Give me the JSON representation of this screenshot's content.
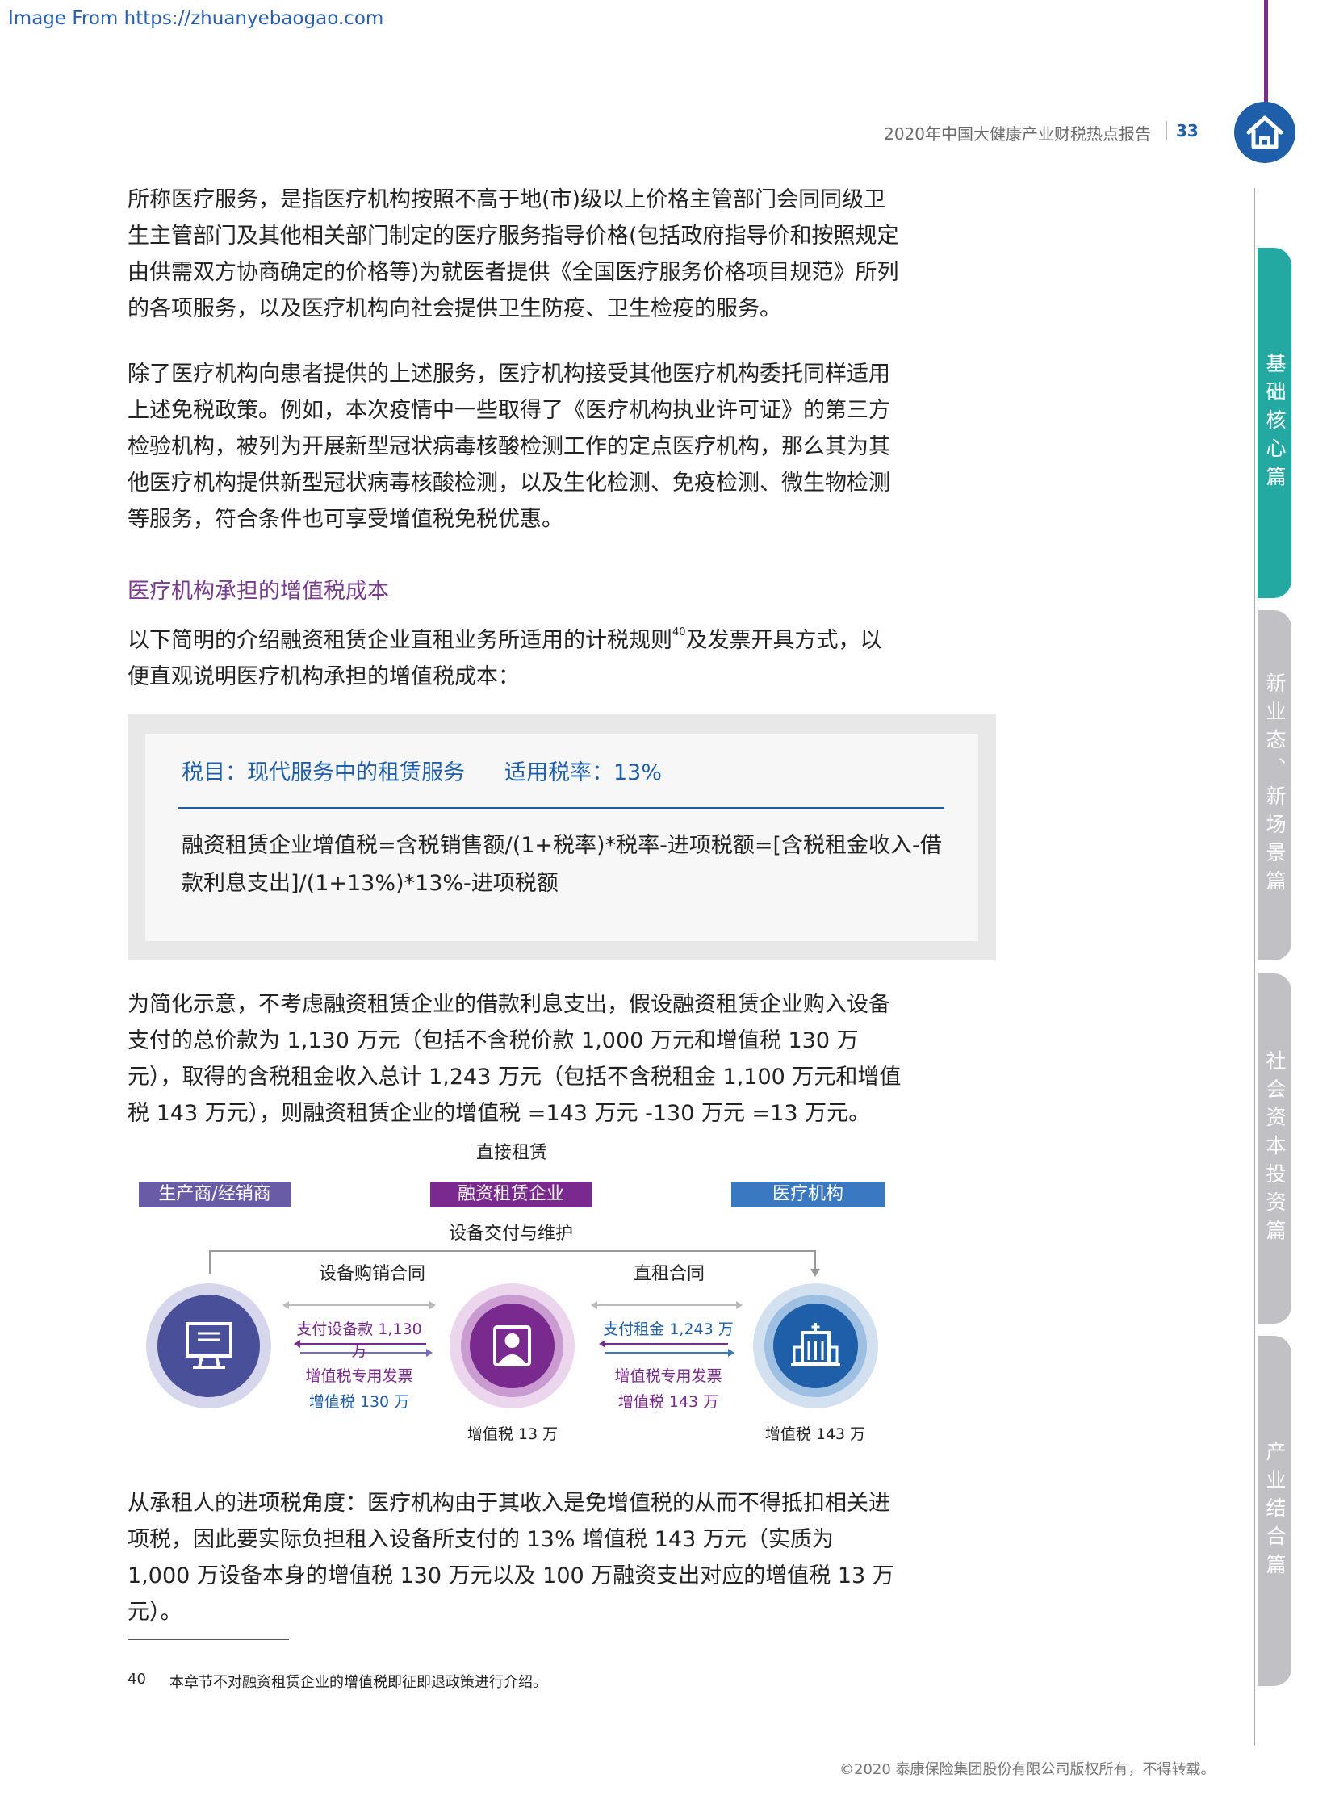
{
  "watermark": "Image From https://zhuanyebaogao.com",
  "header": {
    "title": "2020年中国大健康产业财税热点报告",
    "page_number": "33"
  },
  "side_tabs": [
    {
      "label": "基础核心篇",
      "active": true
    },
    {
      "label": "新业态、新场景篇",
      "active": false
    },
    {
      "label": "社会资本投资篇",
      "active": false
    },
    {
      "label": "产业结合篇",
      "active": false
    }
  ],
  "paragraphs": {
    "p1": "所称医疗服务，是指医疗机构按照不高于地(市)级以上价格主管部门会同同级卫生主管部门及其他相关部门制定的医疗服务指导价格(包括政府指导价和按照规定由供需双方协商确定的价格等)为就医者提供《全国医疗服务价格项目规范》所列的各项服务，以及医疗机构向社会提供卫生防疫、卫生检疫的服务。",
    "p2": "除了医疗机构向患者提供的上述服务，医疗机构接受其他医疗机构委托同样适用上述免税政策。例如，本次疫情中一些取得了《医疗机构执业许可证》的第三方检验机构，被列为开展新型冠状病毒核酸检测工作的定点医疗机构，那么其为其他医疗机构提供新型冠状病毒核酸检测，以及生化检测、免疫检测、微生物检测等服务，符合条件也可享受增值税免税优惠。",
    "section_title": "医疗机构承担的增值税成本",
    "p3_before": "以下简明的介绍融资租赁企业直租业务所适用的计税规则",
    "p3_sup": "40",
    "p3_after": "及发票开具方式，以便直观说明医疗机构承担的增值税成本：",
    "p4": "为简化示意，不考虑融资租赁企业的借款利息支出，假设融资租赁企业购入设备支付的总价款为 1,130 万元（包括不含税价款 1,000 万元和增值税 130 万元），取得的含税租金收入总计 1,243 万元（包括不含税租金 1,100 万元和增值税 143 万元），则融资租赁企业的增值税 =143 万元 -130 万元 =13 万元。",
    "p5": "从承租人的进项税角度：医疗机构由于其收入是免增值税的从而不得抵扣相关进项税，因此要实际负担租入设备所支付的 13% 增值税 143 万元（实质为 1,000 万设备本身的增值税 130 万元以及 100 万融资支出对应的增值税 13 万元）。"
  },
  "tax_box": {
    "item_label": "税目：现代服务中的租赁服务",
    "rate_label": "适用税率：13%",
    "formula": "融资租赁企业增值税=含税销售额/(1+税率)*税率-进项税额=[含税租金收入-借款利息支出]/(1+13%)*13%-进项税额"
  },
  "diagram": {
    "top_label": "直接租赁",
    "party_producer": "生产商/经销商",
    "party_lessor": "融资租赁企业",
    "party_hospital": "医疗机构",
    "delivery_label": "设备交付与维护",
    "contract_left": "设备购销合同",
    "contract_right": "直租合同",
    "pay_left": "支付设备款 1,130 万",
    "invoice_left": "增值税专用发票",
    "tax_left": "增值税 130 万",
    "pay_right": "支付租金 1,243 万",
    "invoice_right": "增值税专用发票",
    "tax_right": "增值税 143 万",
    "lessor_vat": "增值税 13 万",
    "hospital_vat": "增值税 143 万",
    "colors": {
      "producer": "#6a5ba6",
      "lessor": "#7a2a8e",
      "hospital": "#3a78c2"
    },
    "icons": {
      "producer": "computer-icon",
      "lessor": "person-icon",
      "hospital": "hospital-building-icon"
    }
  },
  "footnote": {
    "number": "40",
    "text": "本章节不对融资租赁企业的增值税即征即退政策进行介绍。"
  },
  "copyright": "©2020 泰康保险集团股份有限公司版权所有，不得转载。"
}
